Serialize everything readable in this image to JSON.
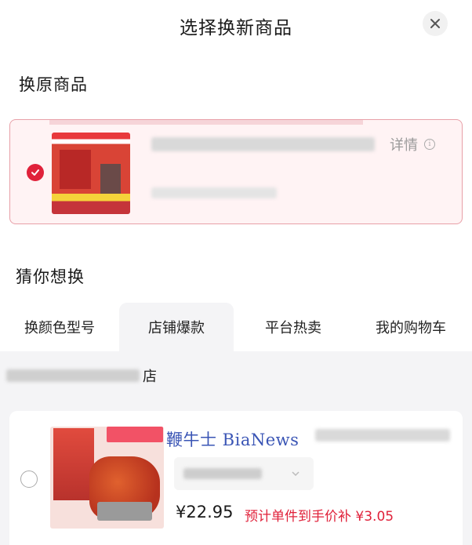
{
  "header": {
    "title": "选择换新商品"
  },
  "original_section": {
    "title": "换原商品",
    "detail_label": "详情"
  },
  "guess_section": {
    "title": "猜你想换"
  },
  "tabs": [
    {
      "label": "换颜色型号",
      "active": false
    },
    {
      "label": "店铺爆款",
      "active": true
    },
    {
      "label": "平台热卖",
      "active": false
    },
    {
      "label": "我的购物车",
      "active": false
    }
  ],
  "shop": {
    "name_suffix": "店"
  },
  "product": {
    "price": "¥22.95",
    "subsidy": "预计单件到手价补 ¥3.05"
  },
  "watermark": "鞭牛士 BiaNews",
  "colors": {
    "accent": "#e0213a",
    "card_border": "#e8a0a8",
    "watermark": "#3a55b5"
  }
}
